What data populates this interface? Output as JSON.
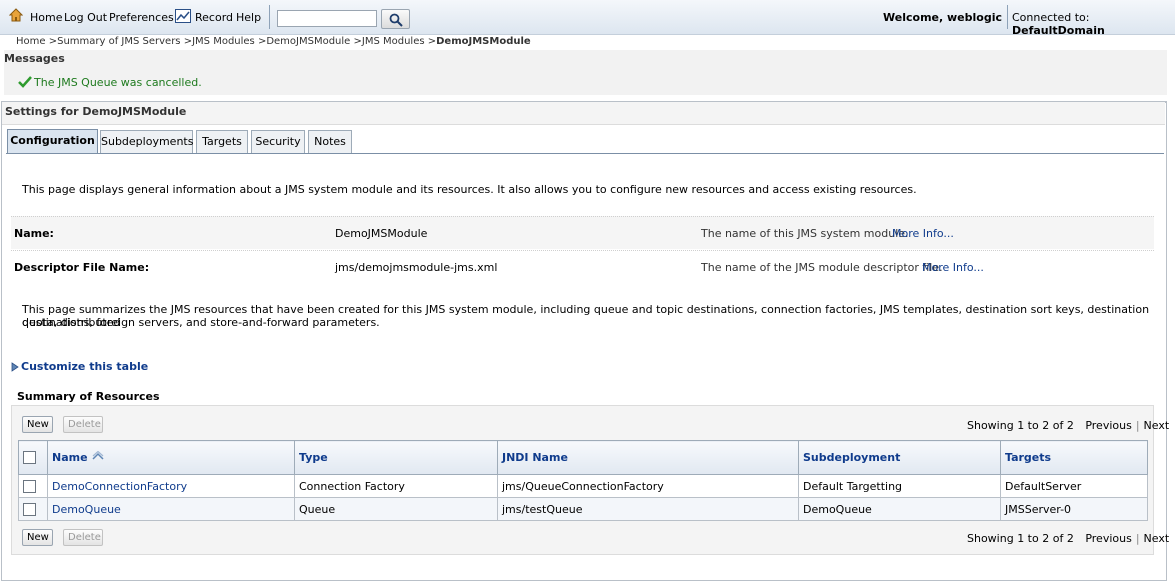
{
  "topbar": {
    "home": "Home",
    "logout": "Log Out",
    "preferences": "Preferences",
    "record": "Record",
    "help": "Help",
    "search_value": "",
    "welcome": "Welcome, weblogic",
    "connected_label": "Connected to:",
    "connected_domain": "DefaultDomain"
  },
  "breadcrumb": {
    "items": [
      "Home >",
      "Summary of JMS Servers >",
      "JMS Modules >",
      "DemoJMSModule >",
      "JMS Modules >"
    ],
    "current": "DemoJMSModule"
  },
  "messages": {
    "title": "Messages",
    "text": "The JMS Queue was cancelled."
  },
  "settings": {
    "title": "Settings for DemoJMSModule",
    "tabs": [
      "Configuration",
      "Subdeployments",
      "Targets",
      "Security",
      "Notes"
    ],
    "active_tab": "Configuration",
    "intro": "This page displays general information about a JMS system module and its resources. It also allows you to configure new resources and access existing resources.",
    "attributes": [
      {
        "label": "Name:",
        "value": "DemoJMSModule",
        "help": "The name of this JMS system module.",
        "more": "More Info..."
      },
      {
        "label": "Descriptor File Name:",
        "value": "jms/demojmsmodule-jms.xml",
        "help": "The name of the JMS module descriptor file.",
        "more": "More Info..."
      }
    ],
    "summary_para_1": "This page summarizes the JMS resources that have been created for this JMS system module, including queue and topic destinations, connection factories, JMS templates, destination sort keys, destination quota, distributed",
    "summary_para_2": "destinations, foreign servers, and store-and-forward parameters.",
    "customize": "Customize this table",
    "summary_title": "Summary of Resources",
    "new_label": "New",
    "delete_label": "Delete",
    "showing": "Showing 1 to 2 of 2",
    "previous": "Previous",
    "next": "Next",
    "columns": [
      "Name",
      "Type",
      "JNDI Name",
      "Subdeployment",
      "Targets"
    ],
    "rows": [
      {
        "name": "DemoConnectionFactory",
        "type": "Connection Factory",
        "jndi": "jms/QueueConnectionFactory",
        "subdeployment": "Default Targetting",
        "targets": "DefaultServer"
      },
      {
        "name": "DemoQueue",
        "type": "Queue",
        "jndi": "jms/testQueue",
        "subdeployment": "DemoQueue",
        "targets": "JMSServer-0"
      }
    ]
  },
  "colors": {
    "link": "#0f3b8c",
    "message": "#1e7a1e",
    "header_bg": "#dde6f0"
  }
}
